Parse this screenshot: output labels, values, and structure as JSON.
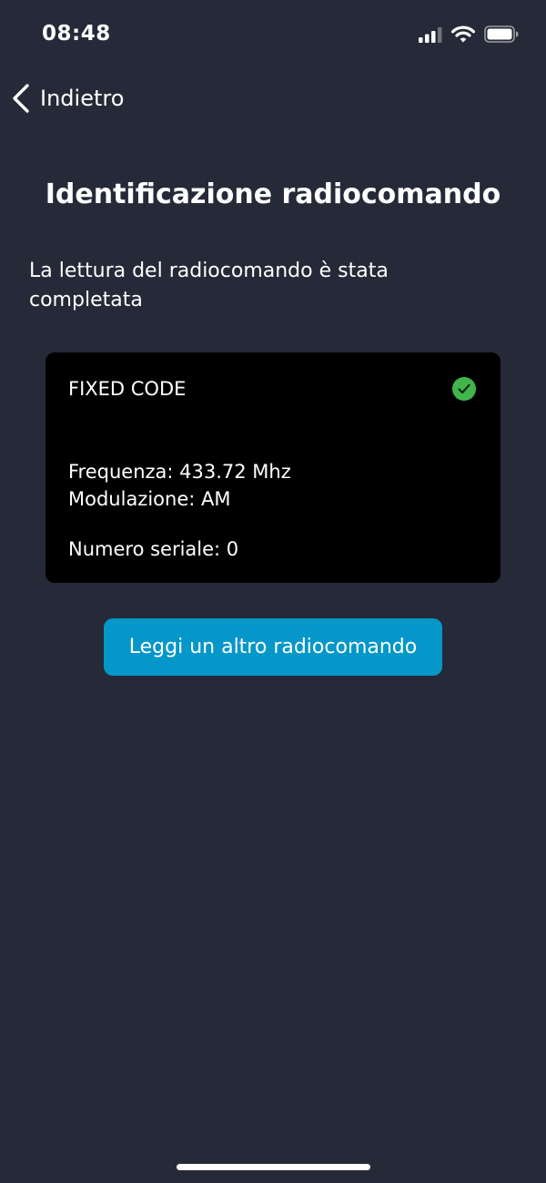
{
  "status_bar": {
    "time": "08:48",
    "icons": [
      "cellular-signal-icon",
      "wifi-icon",
      "battery-icon"
    ]
  },
  "nav": {
    "back_label": "Indietro"
  },
  "page": {
    "title": "Identificazione radiocomando",
    "description": "La lettura del radiocomando è stata completata"
  },
  "result_card": {
    "type": "FIXED CODE",
    "status_icon": "check-circle-icon",
    "frequency": "Frequenza: 433.72 Mhz",
    "modulation": "Modulazione: AM",
    "serial": "Numero seriale: 0"
  },
  "actions": {
    "read_again_label": "Leggi un altro radiocomando"
  },
  "colors": {
    "background": "#262937",
    "card_background": "#000000",
    "button_background": "#0597c9",
    "success": "#3fb54b",
    "text": "#ffffff"
  }
}
